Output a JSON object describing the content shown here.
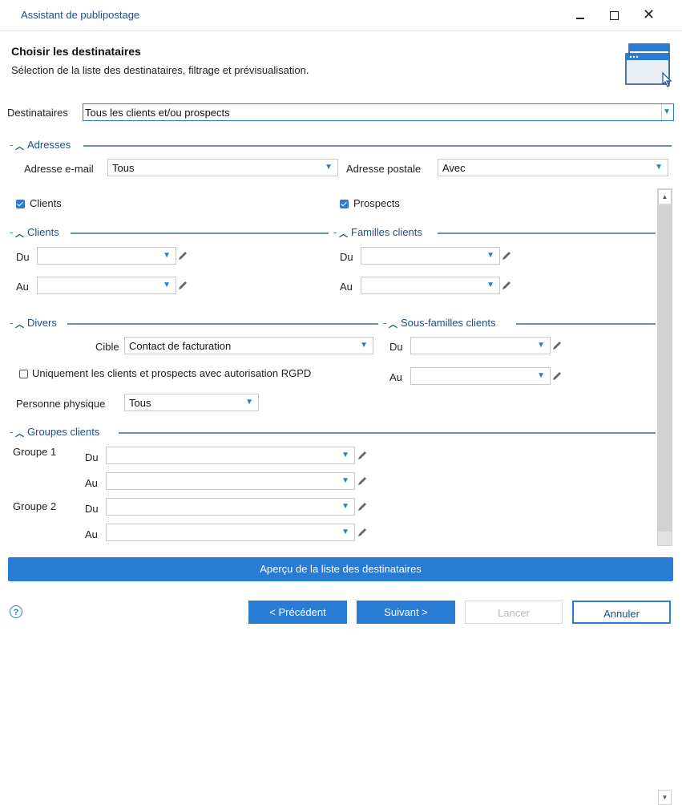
{
  "window": {
    "title": "Assistant de publipostage",
    "minimize_icon": "minimize-icon",
    "maximize_icon": "maximize-icon",
    "close_glyph": "✕"
  },
  "header": {
    "title": "Choisir les destinataires",
    "subtitle": "Sélection de la liste des destinataires, filtrage et prévisualisation."
  },
  "destinataires": {
    "label": "Destinataires",
    "value": "Tous les clients et/ou prospects"
  },
  "adresses": {
    "section": "Adresses",
    "email_label": "Adresse e-mail",
    "email_value": "Tous",
    "postal_label": "Adresse postale",
    "postal_value": "Avec"
  },
  "checks": {
    "clients": {
      "label": "Clients",
      "checked": true
    },
    "prospects": {
      "label": "Prospects",
      "checked": true
    }
  },
  "clients": {
    "section": "Clients",
    "du_label": "Du",
    "au_label": "Au",
    "du_value": "",
    "au_value": ""
  },
  "familles_clients": {
    "section": "Familles clients",
    "du_label": "Du",
    "au_label": "Au",
    "du_value": "",
    "au_value": ""
  },
  "divers": {
    "section": "Divers",
    "cible_label": "Cible",
    "cible_value": "Contact de facturation",
    "rgpd_label": "Uniquement les clients et prospects avec autorisation RGPD",
    "rgpd_checked": false,
    "personne_label": "Personne physique",
    "personne_value": "Tous"
  },
  "sous_familles_clients": {
    "section": "Sous-familles clients",
    "du_label": "Du",
    "au_label": "Au",
    "du_value": "",
    "au_value": ""
  },
  "groupes_clients": {
    "section": "Groupes clients",
    "groupe1": "Groupe 1",
    "groupe2": "Groupe 2",
    "du_label": "Du",
    "au_label": "Au"
  },
  "preview_button": "Aperçu de la liste des destinataires",
  "footer": {
    "help": "?",
    "prev": "< Précédent",
    "next": "Suivant >",
    "cancel_disabled": "Lancer",
    "cancel": "Annuler"
  },
  "colors": {
    "accent": "#2a7bd3",
    "title_blue": "#1e4f86"
  }
}
